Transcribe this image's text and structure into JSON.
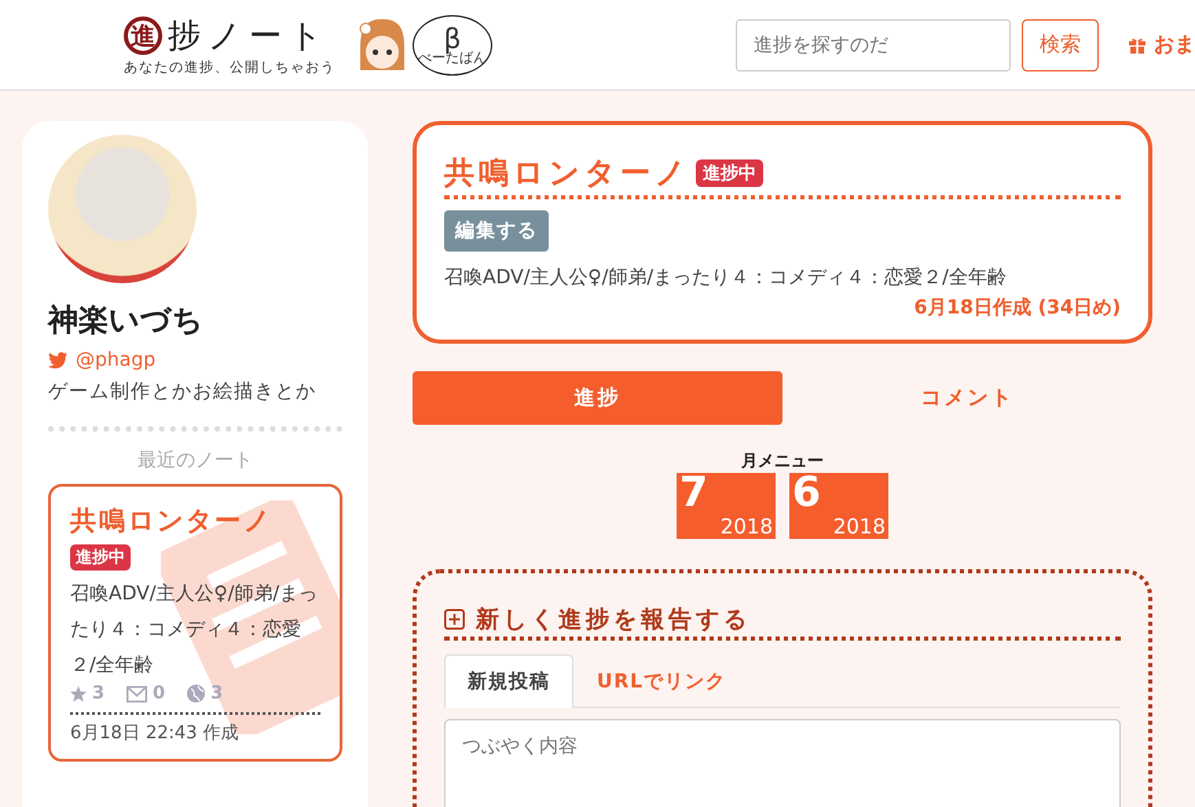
{
  "header": {
    "logo_mark": "進",
    "logo_text": "捗ノート",
    "tagline": "あなたの進捗、公開しちゃおう",
    "beta_symbol": "β",
    "beta_label": "べーたばん",
    "search": {
      "placeholder": "進捗を探すのだ"
    },
    "search_button": "検索",
    "gift_link": "おま"
  },
  "profile": {
    "name": "神楽いづち",
    "twitter": "@phagp",
    "bio": "ゲーム制作とかお絵描きとか",
    "recent_heading": "最近のノート",
    "recent_note": {
      "title": "共鳴ロンターノ",
      "badge": "進捗中",
      "tags": "召喚ADV/主人公♀/師弟/まったり４：コメディ４：恋愛２/全年齢",
      "favorites": "3",
      "comments": "0",
      "views": "3",
      "created": "6月18日 22:43 作成"
    }
  },
  "note": {
    "title": "共鳴ロンターノ",
    "badge": "進捗中",
    "edit_button": "編集する",
    "tags": "召喚ADV/主人公♀/師弟/まったり４：コメディ４：恋愛２/全年齢",
    "created": "6月18日作成 (34日め)"
  },
  "tabs": [
    {
      "label": "進捗",
      "selected": true
    },
    {
      "label": "コメント",
      "selected": false
    }
  ],
  "month_menu": {
    "title": "月メニュー",
    "months": [
      {
        "month": "7",
        "year": "2018"
      },
      {
        "month": "6",
        "year": "2018"
      }
    ]
  },
  "report": {
    "heading": "新しく進捗を報告する",
    "tabs": [
      {
        "label": "新規投稿",
        "selected": true
      },
      {
        "label": "URLでリンク",
        "selected": false
      }
    ],
    "textarea": {
      "placeholder": "つぶやく内容"
    }
  }
}
